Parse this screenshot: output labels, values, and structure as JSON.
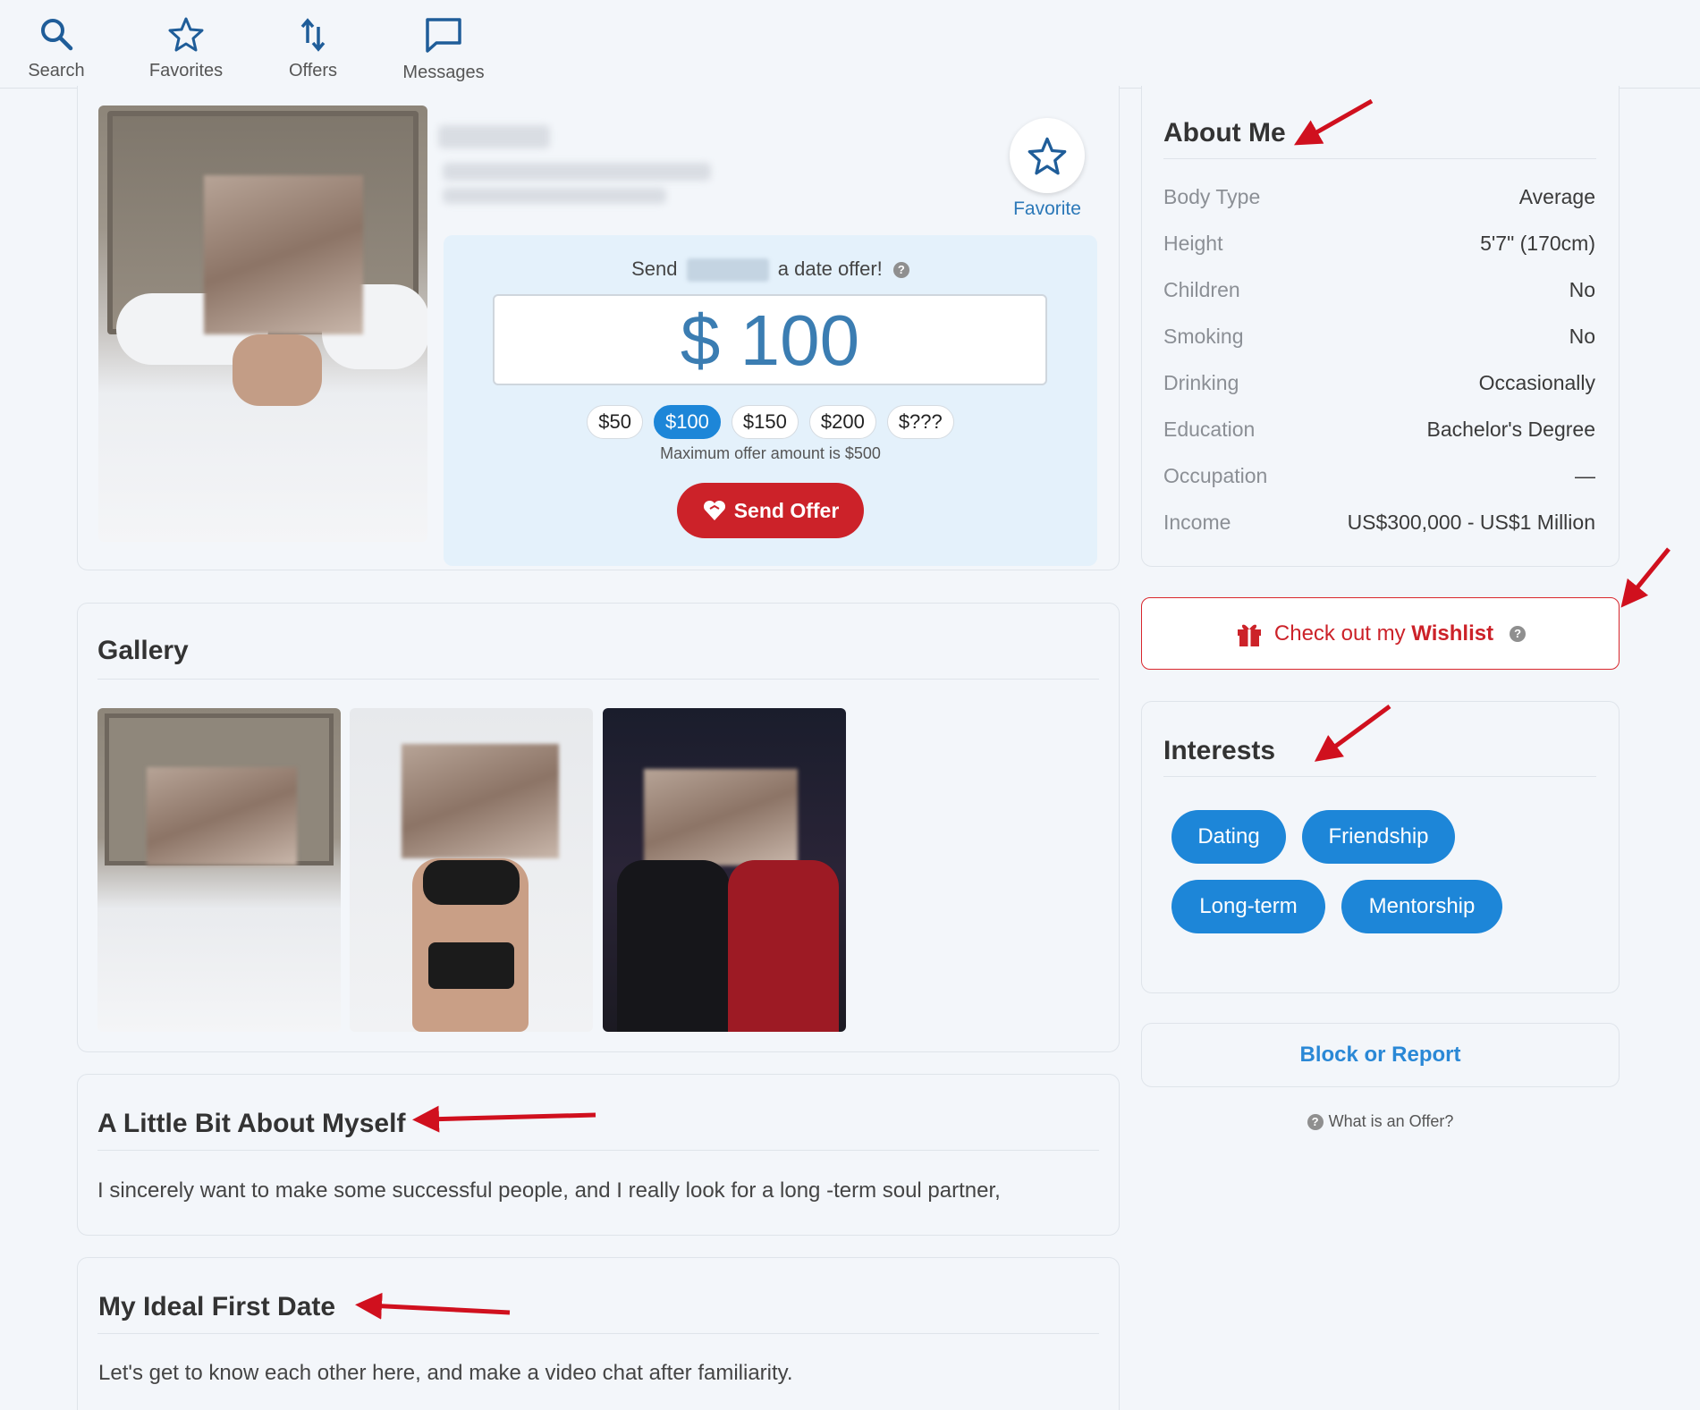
{
  "nav": {
    "items": [
      {
        "label": "Search",
        "icon": "search-icon"
      },
      {
        "label": "Favorites",
        "icon": "star-icon"
      },
      {
        "label": "Offers",
        "icon": "arrows-updown-icon"
      },
      {
        "label": "Messages",
        "icon": "chat-bubble-icon"
      }
    ]
  },
  "profile": {
    "favorite_label": "Favorite",
    "offer": {
      "send_prefix": "Send",
      "send_suffix": "a date offer!",
      "help": "?",
      "currency_symbol": "$",
      "amount": "100",
      "chips": [
        "$50",
        "$100",
        "$150",
        "$200",
        "$???"
      ],
      "selected_chip": "$100",
      "max_note": "Maximum offer amount is $500",
      "send_button": "Send Offer"
    }
  },
  "gallery": {
    "title": "Gallery"
  },
  "about_myself": {
    "title": "A Little Bit About Myself",
    "text": "I sincerely want to make some successful people, and I really look for a long -term soul partner,"
  },
  "ideal_date": {
    "title": "My Ideal First Date",
    "text": "Let's get to know each other here, and make a video chat after familiarity."
  },
  "about_me": {
    "title": "About Me",
    "rows": [
      {
        "label": "Body Type",
        "value": "Average"
      },
      {
        "label": "Height",
        "value": "5'7\" (170cm)"
      },
      {
        "label": "Children",
        "value": "No"
      },
      {
        "label": "Smoking",
        "value": "No"
      },
      {
        "label": "Drinking",
        "value": "Occasionally"
      },
      {
        "label": "Education",
        "value": "Bachelor's Degree"
      },
      {
        "label": "Occupation",
        "value": "—"
      },
      {
        "label": "Income",
        "value": "US$300,000 - US$1 Million"
      }
    ]
  },
  "wishlist": {
    "prefix": "Check out my",
    "bold": "Wishlist",
    "help": "?"
  },
  "interests": {
    "title": "Interests",
    "tags": [
      "Dating",
      "Friendship",
      "Long-term",
      "Mentorship"
    ]
  },
  "block_report": "Block or Report",
  "what_is_offer": "What is an Offer?",
  "colors": {
    "accent_blue": "#1d86d8",
    "brand_red": "#cc2229",
    "annotation_arrow": "#d0101e",
    "page_bg": "#f3f6fa"
  }
}
